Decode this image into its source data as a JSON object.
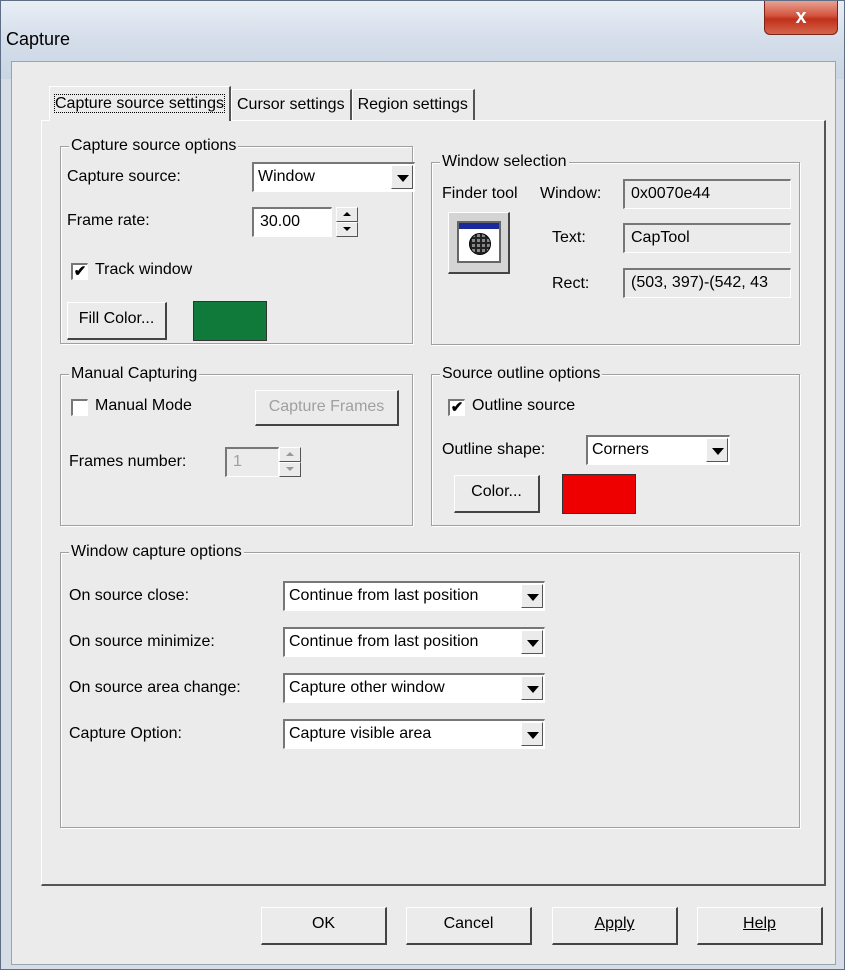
{
  "window": {
    "title": "Capture",
    "close_label": "x"
  },
  "tabs": [
    {
      "label": "Capture source settings"
    },
    {
      "label": "Cursor settings"
    },
    {
      "label": "Region settings"
    }
  ],
  "capture_source_options": {
    "group_title": "Capture source options",
    "capture_source_label": "Capture source:",
    "capture_source_value": "Window",
    "frame_rate_label": "Frame rate:",
    "frame_rate_value": "30.00",
    "track_window_label": "Track window",
    "track_window_checked": true,
    "fill_color_label": "Fill Color...",
    "fill_color": "#0f7a3a"
  },
  "window_selection": {
    "group_title": "Window selection",
    "finder_tool_label": "Finder tool",
    "window_label": "Window:",
    "window_value": "0x0070e44",
    "text_label": "Text:",
    "text_value": "CapTool",
    "rect_label": "Rect:",
    "rect_value": "(503, 397)-(542, 43"
  },
  "manual_capturing": {
    "group_title": "Manual Capturing",
    "manual_mode_label": "Manual Mode",
    "manual_mode_checked": false,
    "capture_frames_label": "Capture Frames",
    "frames_number_label": "Frames number:",
    "frames_number_value": "1"
  },
  "source_outline_options": {
    "group_title": "Source outline options",
    "outline_source_label": "Outline source",
    "outline_source_checked": true,
    "outline_shape_label": "Outline shape:",
    "outline_shape_value": "Corners",
    "color_label": "Color...",
    "outline_color": "#ee0000"
  },
  "window_capture_options": {
    "group_title": "Window capture options",
    "rows": [
      {
        "label": "On source close:",
        "value": "Continue from last position"
      },
      {
        "label": "On source minimize:",
        "value": "Continue from last position"
      },
      {
        "label": "On source area change:",
        "value": "Capture other window"
      },
      {
        "label": "Capture Option:",
        "value": "Capture visible area"
      }
    ]
  },
  "footer": {
    "ok_label": "OK",
    "cancel_label": "Cancel",
    "apply_label": "Apply",
    "help_label": "Help"
  },
  "check_mark": "✔"
}
